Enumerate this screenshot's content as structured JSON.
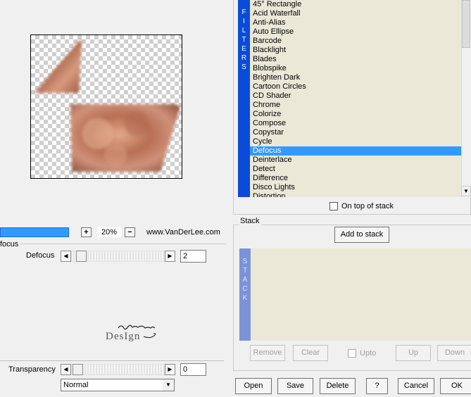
{
  "preview": {
    "zoom": "20%",
    "zoom_plus": "+",
    "zoom_minus": "−",
    "website": "www.VanDerLee.com"
  },
  "filter_panel": {
    "title": "focus",
    "param_label": "Defocus",
    "param_value": "2",
    "logo_text": "Monaiekje Design"
  },
  "transparency": {
    "label": "Transparency",
    "value": "0"
  },
  "blend_mode": {
    "selected": "Normal"
  },
  "filters": {
    "strip_letters": [
      "F",
      "I",
      "L",
      "T",
      "E",
      "R",
      "S"
    ],
    "items": [
      "45° Rectangle",
      "Acid Waterfall",
      "Anti-Alias",
      "Auto Ellipse",
      "Barcode",
      "Blacklight",
      "Blades",
      "Blobspike",
      "Brighten Dark",
      "Cartoon Circles",
      "CD Shader",
      "Chrome",
      "Colorize",
      "Compose",
      "Copystar",
      "Cycle",
      "Defocus",
      "Deinterlace",
      "Detect",
      "Difference",
      "Disco Lights",
      "Distortion"
    ],
    "selected": "Defocus",
    "on_top_label": "On top of stack"
  },
  "stack": {
    "title": "Stack",
    "add_button": "Add to stack",
    "strip_letters": [
      "S",
      "T",
      "A",
      "C",
      "K"
    ],
    "remove": "Remove",
    "clear": "Clear",
    "upto": "Upto",
    "up": "Up",
    "down": "Down"
  },
  "footer": {
    "open": "Open",
    "save": "Save",
    "delete": "Delete",
    "help": "?",
    "cancel": "Cancel",
    "ok": "OK"
  },
  "colors": {
    "selection": "#3399ff",
    "filters_strip": "#0b4bd8",
    "stack_strip": "#7b93d6",
    "list_bg": "#ebe8d8"
  }
}
